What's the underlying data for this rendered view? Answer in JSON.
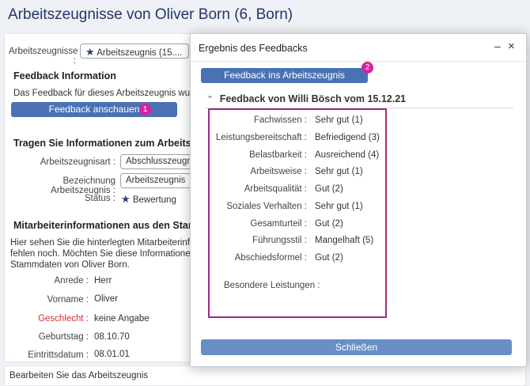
{
  "page": {
    "title": "Arbeitszeugnisse von Oliver Born (6, Born)"
  },
  "background": {
    "select_label": "Arbeitszeugnisse :",
    "select_value": "Arbeitszeugnis (15....",
    "feedback_section_title": "Feedback Information",
    "feedback_text": "Das Feedback für dieses Arbeitszeugnis wurde vo",
    "view_feedback_button": "Feedback anschauen",
    "badge_1": "1",
    "info_section_title": "Tragen Sie Informationen zum Arbeitszeugni",
    "type_label": "Arbeitszeugnisart :",
    "type_value": "Abschlusszeugnis",
    "name_label": "Bezeichnung Arbeitszeugnis :",
    "name_value": "Arbeitszeugnis",
    "status_label": "Status :",
    "status_value": "Bewertung",
    "master_section_title": "Mitarbeiterinformationen aus den Stammdat",
    "master_text_1": "Hier sehen Sie die hinterlegten Mitarbeiterinform",
    "master_text_2": "fehlen noch. Möchten Sie diese Informationen be",
    "master_text_3": "Stammdaten von Oliver Born.",
    "salutation_label": "Anrede :",
    "salutation_value": "Herr",
    "firstname_label": "Vorname :",
    "firstname_value": "Oliver",
    "gender_label": "Geschlecht :",
    "gender_value": "keine Angabe",
    "birthday_label": "Geburtstag :",
    "birthday_value": "08.10.70",
    "entry_label": "Eintrittsdatum :",
    "entry_value": "08.01.01",
    "footer_text": "Bearbeiten Sie das Arbeitszeugnis",
    "gender_color": "#cc3333",
    "brand_color": "#4a72b2",
    "badge_color": "#d6249f"
  },
  "dialog": {
    "title": "Ergebnis des Feedbacks",
    "minimize_icon": "minimize-icon",
    "close_icon": "close-icon",
    "transfer_button": "Feedback ins Arbeitszeugnis übertragen",
    "badge_2": "2",
    "feedback_heading": "Feedback von Willi Bösch vom 15.12.21",
    "rows": [
      {
        "label": "Fachwissen :",
        "value": "Sehr gut (1)"
      },
      {
        "label": "Leistungsbereitschaft :",
        "value": "Befriedigend (3)"
      },
      {
        "label": "Belastbarkeit :",
        "value": "Ausreichend (4)"
      },
      {
        "label": "Arbeitsweise :",
        "value": "Sehr gut (1)"
      },
      {
        "label": "Arbeitsqualität :",
        "value": "Gut (2)"
      },
      {
        "label": "Soziales Verhalten :",
        "value": "Sehr gut (1)"
      },
      {
        "label": "Gesamturteil :",
        "value": "Gut (2)"
      },
      {
        "label": "Führungsstil :",
        "value": "Mangelhaft (5)"
      },
      {
        "label": "Abschiedsformel :",
        "value": "Gut (2)"
      }
    ],
    "special_label": "Besondere Leistungen :",
    "close_button": "Schließen"
  }
}
